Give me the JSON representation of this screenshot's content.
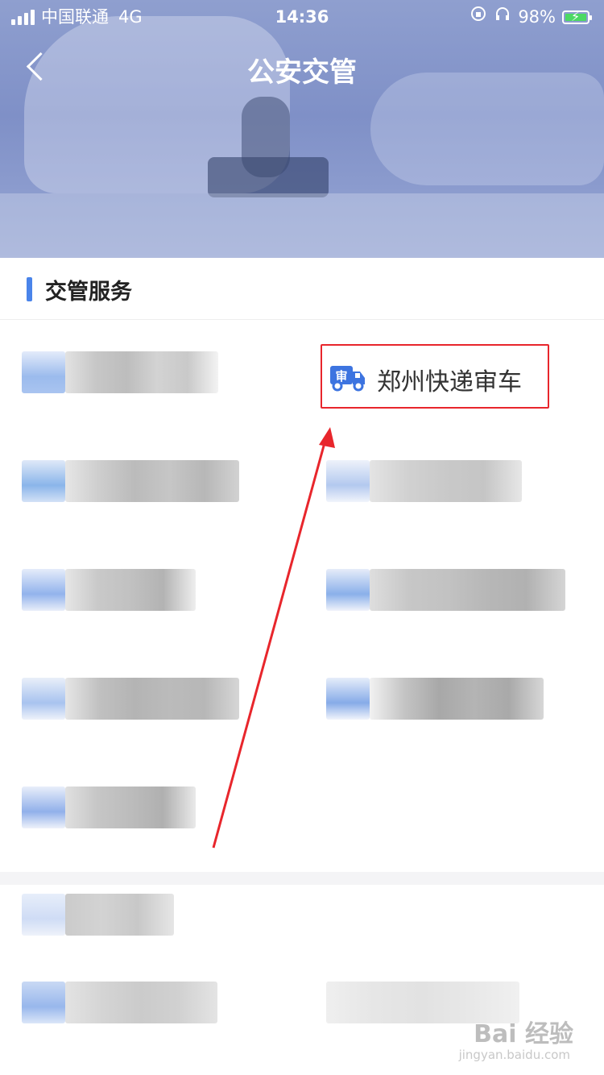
{
  "status_bar": {
    "carrier": "中国联通",
    "network": "4G",
    "time": "14:36",
    "battery": "98%"
  },
  "nav": {
    "title": "公安交管"
  },
  "section": {
    "title": "交管服务"
  },
  "highlighted_service": {
    "label": "郑州快递审车",
    "icon_text": "审",
    "icon": "truck-icon"
  },
  "watermark": {
    "text": "Bai 经验",
    "url": "jingyan.baidu.com"
  },
  "colors": {
    "accent": "#4a84ea",
    "highlight_border": "#e8262c",
    "arrow": "#e8262c",
    "header": "#8696cc"
  }
}
